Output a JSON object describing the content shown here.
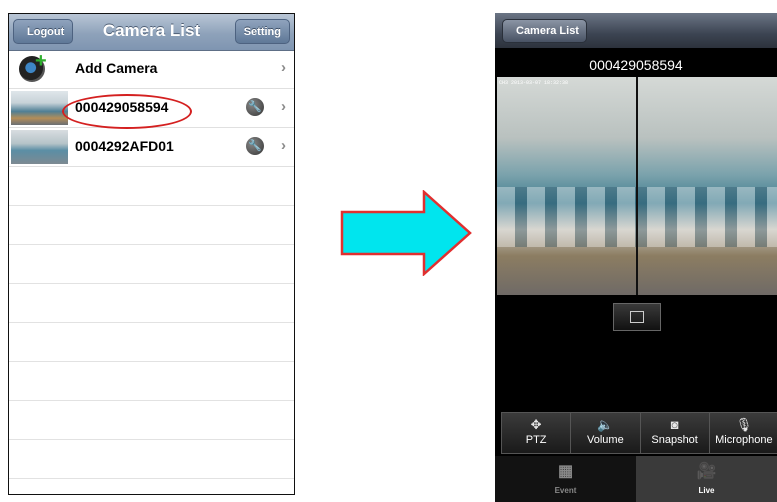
{
  "left": {
    "nav": {
      "logout": "Logout",
      "title": "Camera List",
      "setting": "Setting"
    },
    "rows": [
      {
        "label": "Add Camera"
      },
      {
        "label": "000429058594"
      },
      {
        "label": "0004292AFD01"
      }
    ]
  },
  "right": {
    "nav": {
      "back": "Camera List"
    },
    "title": "000429058594",
    "timestamp": "CH3 2013-03-07 18:32:38",
    "toolbar": [
      "PTZ",
      "Volume",
      "Snapshot",
      "Microphone"
    ],
    "tabs": [
      "Event",
      "Live"
    ],
    "active_tab": "Live"
  },
  "colors": {
    "arrow_fill": "#00e5ee",
    "arrow_border": "#e03030",
    "highlight": "#d42020"
  }
}
